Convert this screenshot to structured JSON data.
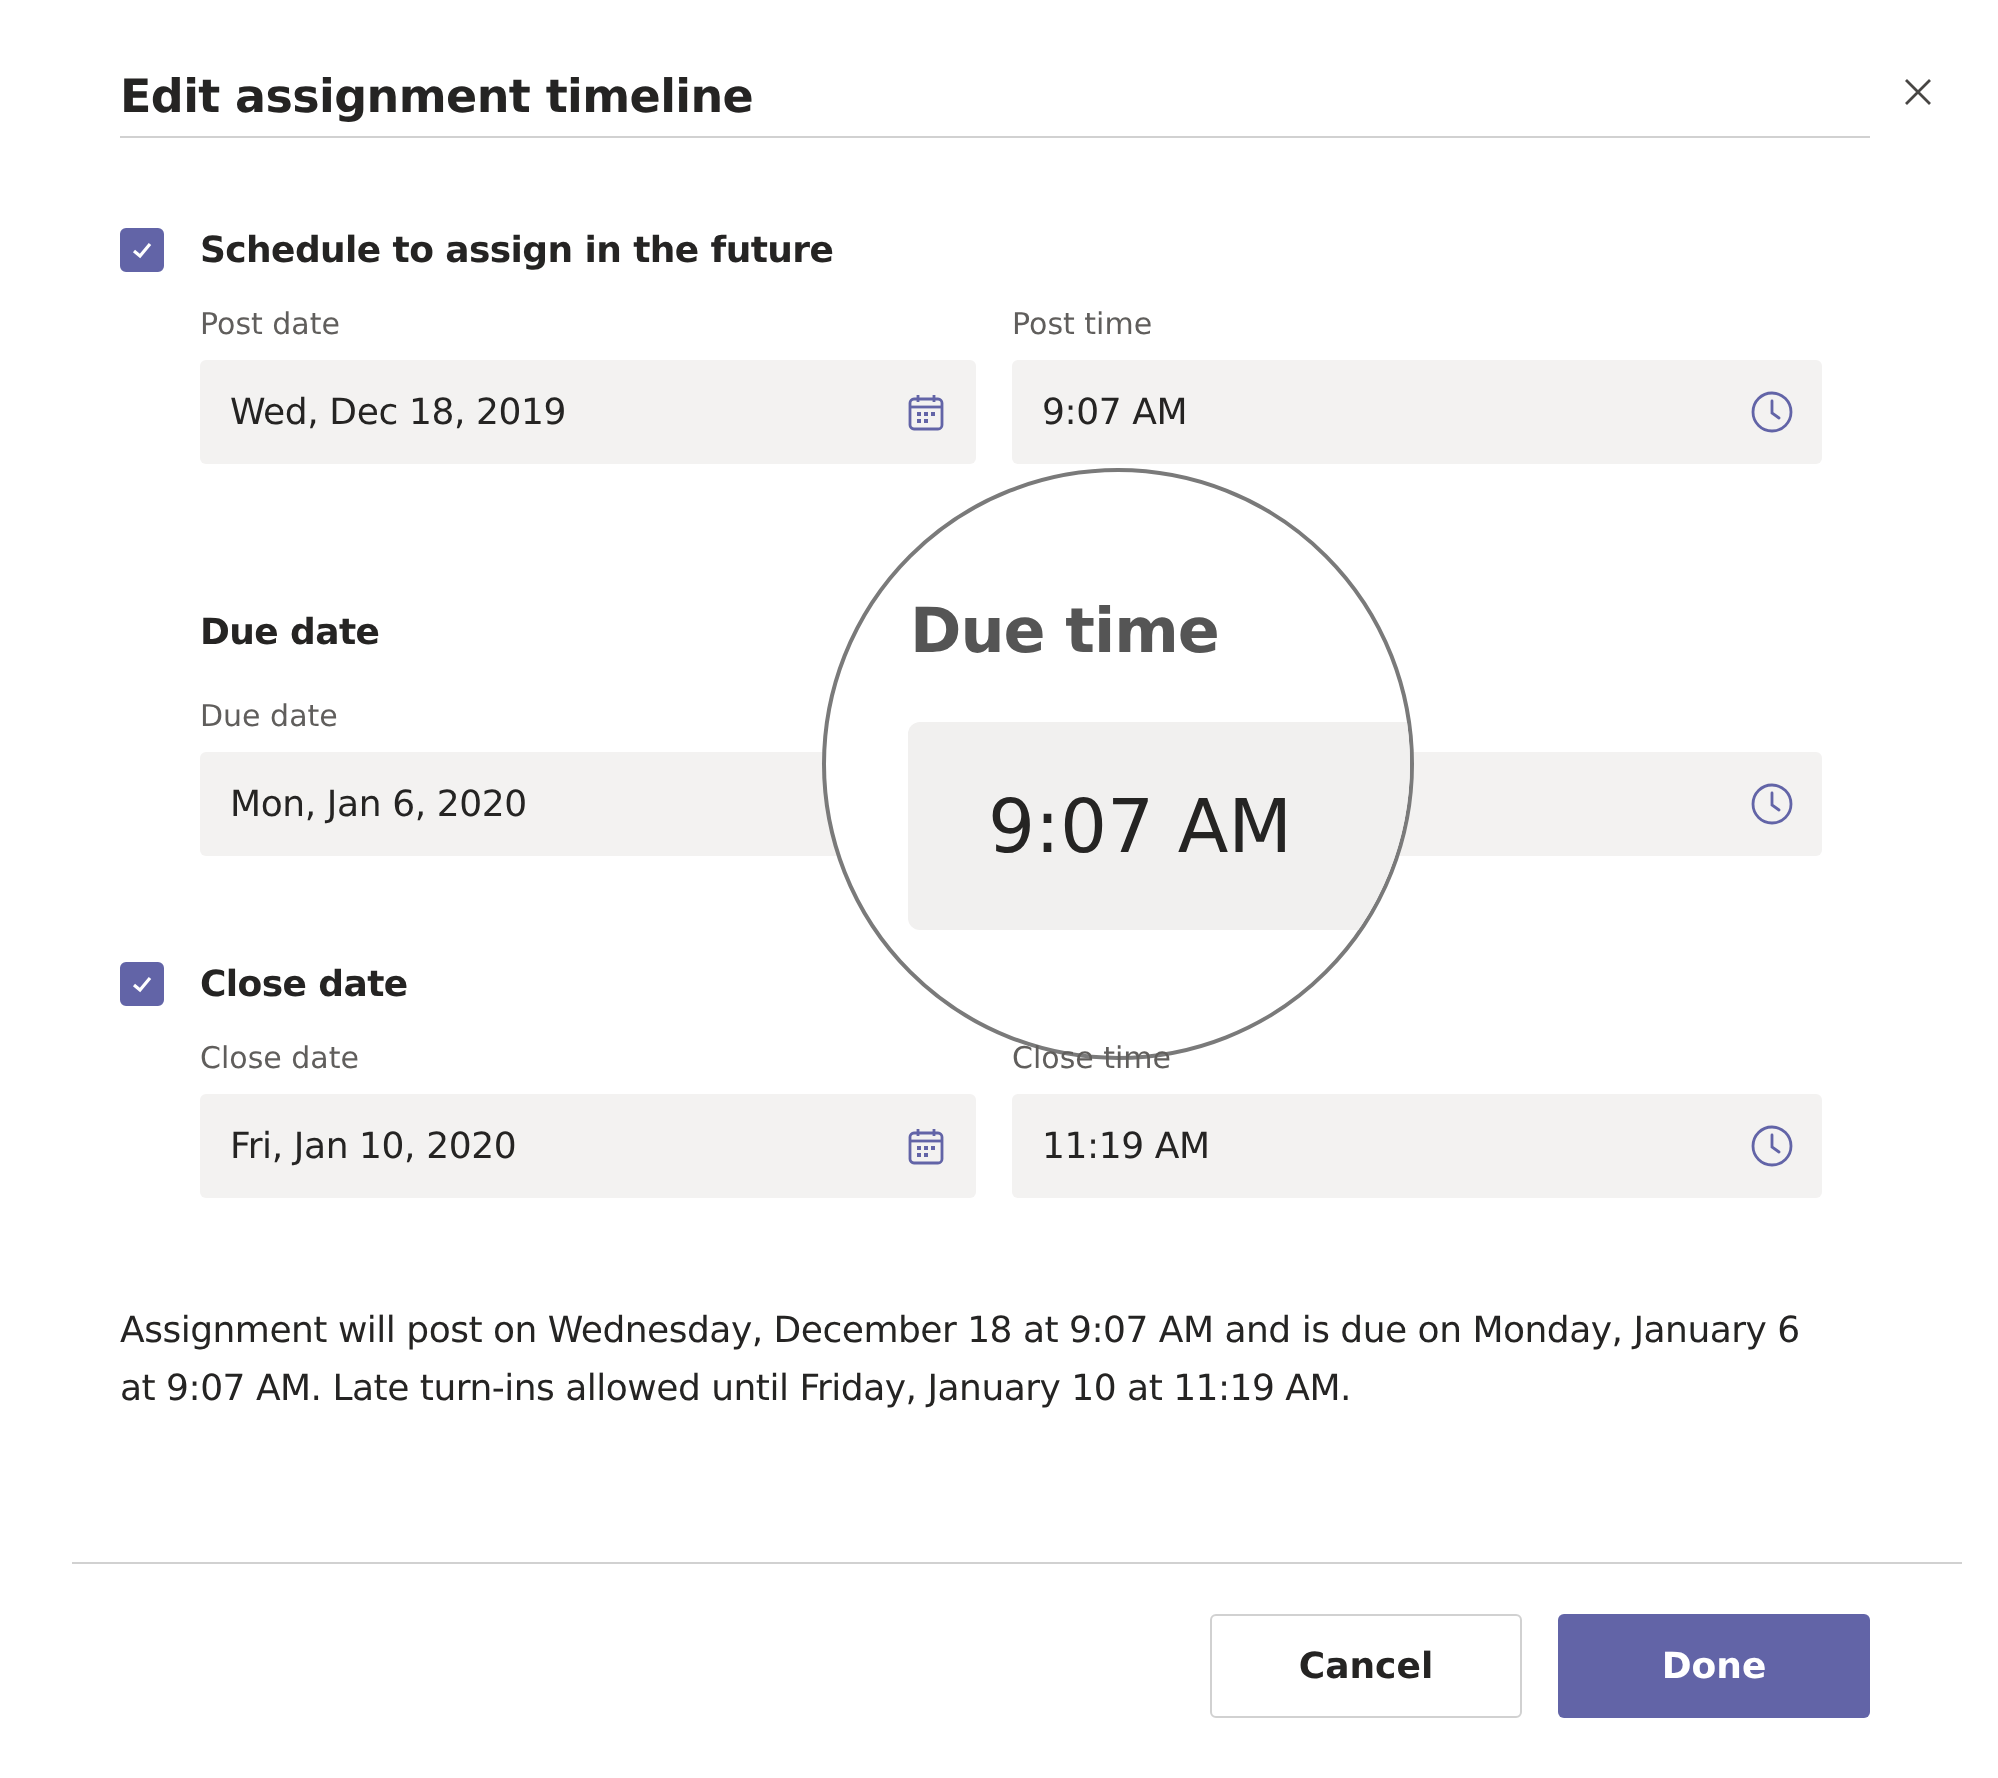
{
  "dialog": {
    "title": "Edit assignment timeline"
  },
  "sections": [
    {
      "kind": "checkbox",
      "label": "Schedule to assign in the future",
      "checked": true,
      "fields": [
        {
          "label": "Post date",
          "value": "Wed, Dec 18, 2019",
          "kind": "date"
        },
        {
          "label": "Post time",
          "value": "9:07 AM",
          "kind": "time"
        }
      ]
    },
    {
      "kind": "heading",
      "label": "Due date",
      "fields": [
        {
          "label": "Due date",
          "value": "Mon, Jan 6, 2020",
          "kind": "covered"
        },
        {
          "kind": "time"
        }
      ]
    },
    {
      "kind": "checkbox",
      "label": "Close date",
      "checked": true,
      "fields": [
        {
          "label": "Close date",
          "value": "Fri, Jan 10, 2020",
          "kind": "date"
        },
        {
          "label": "Close time",
          "value": "11:19 AM",
          "kind": "time"
        }
      ]
    }
  ],
  "summary": "Assignment will post on Wednesday, December 18 at 9:07 AM and is due on Monday, January 6 at 9:07 AM. Late turn-ins allowed until Friday, January 10 at 11:19 AM.",
  "buttons": [
    {
      "label": "Cancel",
      "kind": "secondary"
    },
    {
      "label": "Done",
      "kind": "primary"
    }
  ],
  "magnifier": {
    "label": "Due time",
    "value": "9:07 AM"
  }
}
